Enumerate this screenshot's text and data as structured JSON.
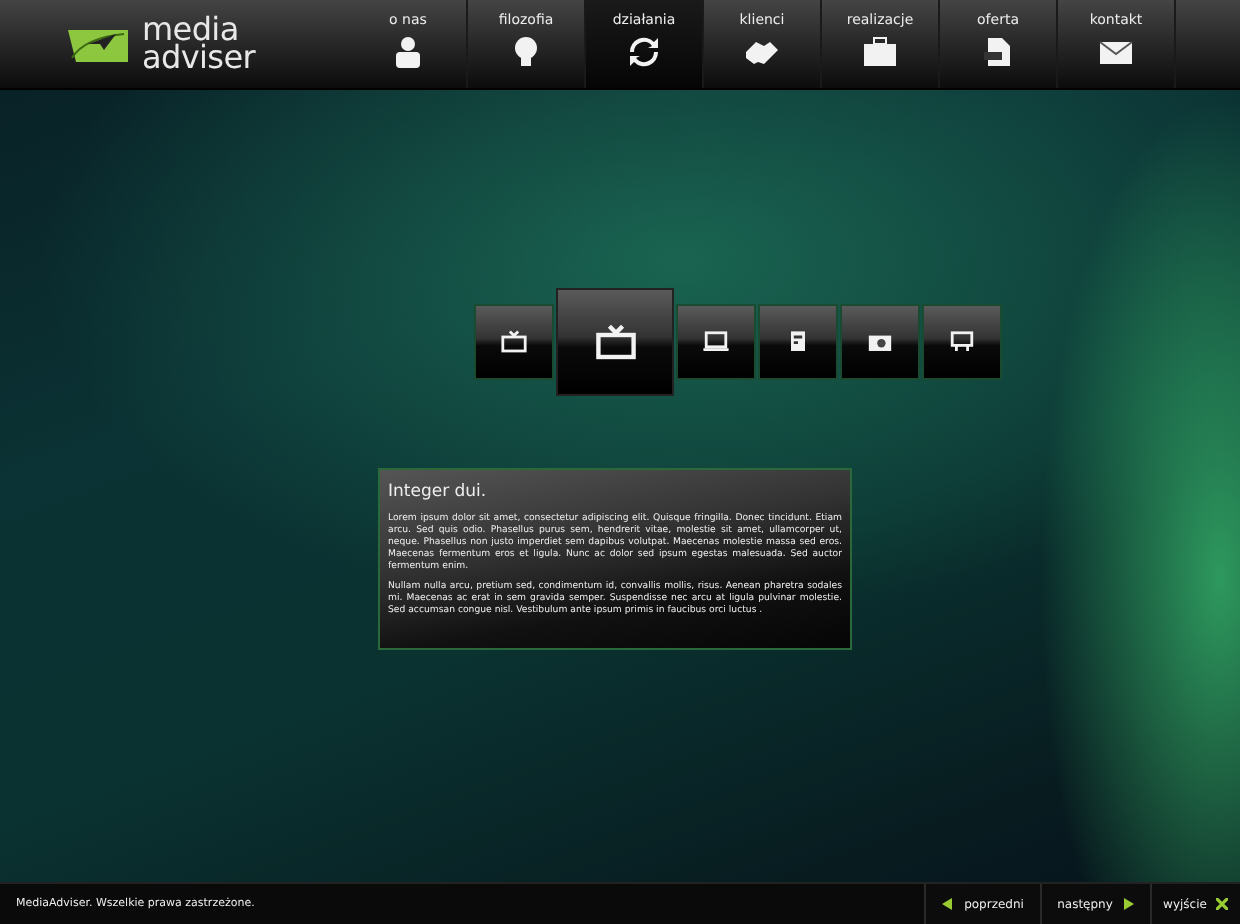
{
  "logo": {
    "line_1": "media",
    "line_2": "adviser"
  },
  "nav": [
    {
      "label": "o nas",
      "kind": "person",
      "selected": false
    },
    {
      "label": "filozofia",
      "kind": "bulb",
      "selected": false
    },
    {
      "label": "działania",
      "kind": "cycle",
      "selected": true
    },
    {
      "label": "klienci",
      "kind": "handshake",
      "selected": false
    },
    {
      "label": "realizacje",
      "kind": "case",
      "selected": false
    },
    {
      "label": "oferta",
      "kind": "doc",
      "selected": false
    },
    {
      "label": "kontakt",
      "kind": "mail",
      "selected": false
    }
  ],
  "tiles": [
    {
      "kind": "tv",
      "selected": false
    },
    {
      "kind": "tv",
      "selected": true
    },
    {
      "kind": "laptop",
      "selected": false
    },
    {
      "kind": "paper",
      "selected": false
    },
    {
      "kind": "camera",
      "selected": false
    },
    {
      "kind": "billboard",
      "selected": false
    }
  ],
  "article": {
    "title": "Integer dui.",
    "paragraphs": [
      "Lorem ipsum dolor sit amet, consectetur adipiscing elit. Quisque fringilla. Donec tincidunt. Etiam arcu. Sed quis odio. Phasellus purus sem, hendrerit vitae, molestie sit amet, ullamcorper ut, neque. Phasellus non justo imperdiet sem dapibus volutpat. Maecenas molestie massa sed eros. Maecenas fermentum eros et ligula. Nunc ac dolor sed ipsum egestas malesuada. Sed auctor fermentum enim.",
      "Nullam nulla arcu, pretium sed, condimentum id, convallis mollis, risus. Aenean pharetra sodales mi. Maecenas ac erat in sem gravida semper. Suspendisse nec arcu at ligula pulvinar molestie. Sed accumsan congue nisl. Vestibulum ante ipsum primis in faucibus orci luctus ."
    ]
  },
  "footer": {
    "copyright": "MediaAdviser. Wszelkie prawa zastrzeżone.",
    "buttons": [
      {
        "label": "poprzedni",
        "kind": "prev"
      },
      {
        "label": "następny",
        "kind": "next"
      },
      {
        "label": "wyjście",
        "kind": "exit"
      }
    ]
  }
}
